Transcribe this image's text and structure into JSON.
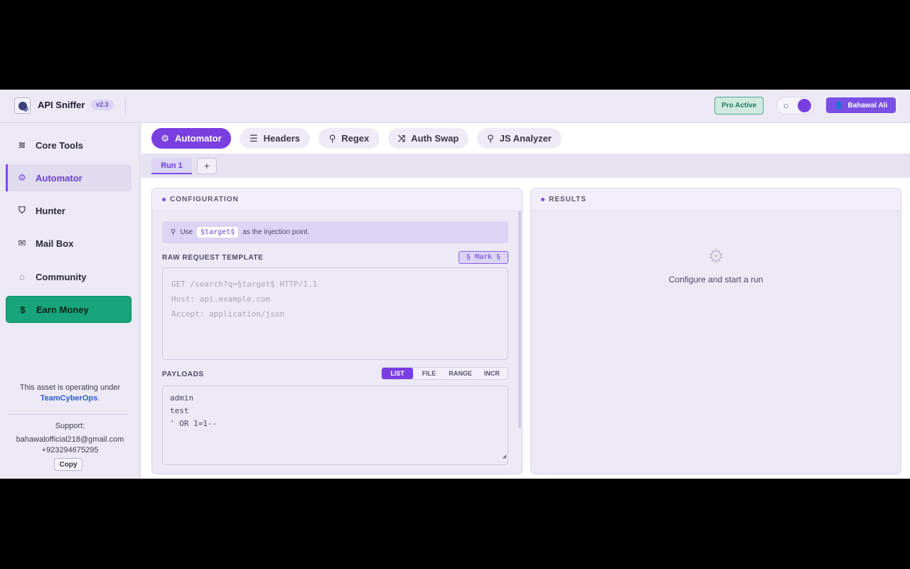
{
  "header": {
    "app_title": "API Sniffer",
    "version": "v2.3",
    "pro_label": "Pro Active",
    "user_name": "Bahawal Ali"
  },
  "sidebar": {
    "items": [
      {
        "label": "Core Tools",
        "icon": "layers-icon"
      },
      {
        "label": "Automator",
        "icon": "gear-icon"
      },
      {
        "label": "Hunter",
        "icon": "shield-icon"
      },
      {
        "label": "Mail Box",
        "icon": "mail-icon"
      },
      {
        "label": "Community",
        "icon": "chat-icon"
      },
      {
        "label": "Earn Money",
        "icon": "dollar-icon"
      }
    ],
    "footer_prefix": "This asset is operating under",
    "footer_org": "TeamCyberOps",
    "footer_suffix": ".",
    "support_label": "Support:",
    "support_email": "bahawalofficial218@gmail.com",
    "support_phone": "+923294675295",
    "copy_label": "Copy"
  },
  "tabs": [
    {
      "label": "Automator",
      "icon": "gear-icon"
    },
    {
      "label": "Headers",
      "icon": "list-icon"
    },
    {
      "label": "Regex",
      "icon": "search-icon"
    },
    {
      "label": "Auth Swap",
      "icon": "shuffle-icon"
    },
    {
      "label": "JS Analyzer",
      "icon": "search-icon"
    }
  ],
  "subtabs": {
    "run_label": "Run 1",
    "add_label": "+"
  },
  "config": {
    "title": "CONFIGURATION",
    "hint_prefix": "Use",
    "hint_code": "§target§",
    "hint_suffix": "as the injection point.",
    "template_label": "RAW REQUEST TEMPLATE",
    "mark_label": "§ Mark §",
    "template_placeholder": "GET /search?q=§target§ HTTP/1.1\nHost: api.example.com\nAccept: application/json",
    "payloads_label": "PAYLOADS",
    "modes": [
      "LIST",
      "FILE",
      "RANGE",
      "INCR"
    ],
    "payloads_value": "admin\ntest\n' OR 1=1--"
  },
  "results": {
    "title": "RESULTS",
    "empty_text": "Configure and start a run"
  },
  "colors": {
    "accent": "#7a3fe0",
    "money": "#17a47a",
    "pro": "#cfe9df"
  }
}
